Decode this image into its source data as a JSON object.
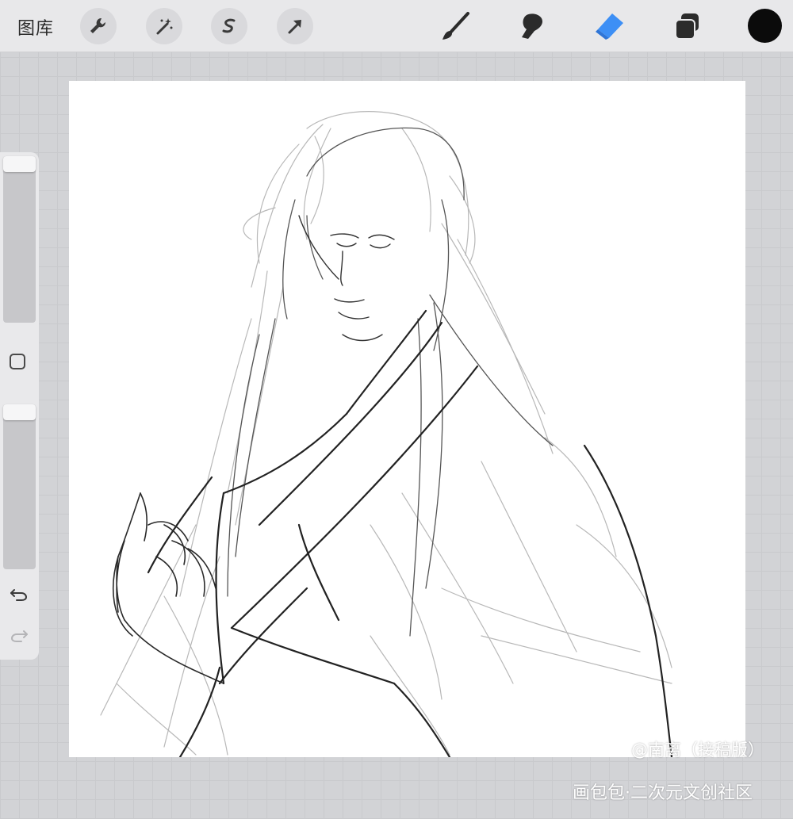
{
  "toolbar": {
    "gallery_label": "图库",
    "left_tools": [
      {
        "icon": "wrench-icon"
      },
      {
        "icon": "magic-wand-icon"
      },
      {
        "icon": "selection-icon"
      },
      {
        "icon": "transform-arrow-icon"
      }
    ],
    "right_tools": [
      {
        "icon": "brush-icon"
      },
      {
        "icon": "smudge-icon"
      },
      {
        "icon": "eraser-icon",
        "active": true
      },
      {
        "icon": "layers-icon"
      }
    ],
    "current_color": "#0b0b0b",
    "active_tool_color": "#3d8ff5"
  },
  "sidebar": {
    "icons": [
      "modify-square-icon",
      "undo-icon",
      "redo-icon"
    ]
  },
  "watermark": {
    "author": "@南离（接稿版）",
    "site": "画包包·二次元文创社区"
  }
}
